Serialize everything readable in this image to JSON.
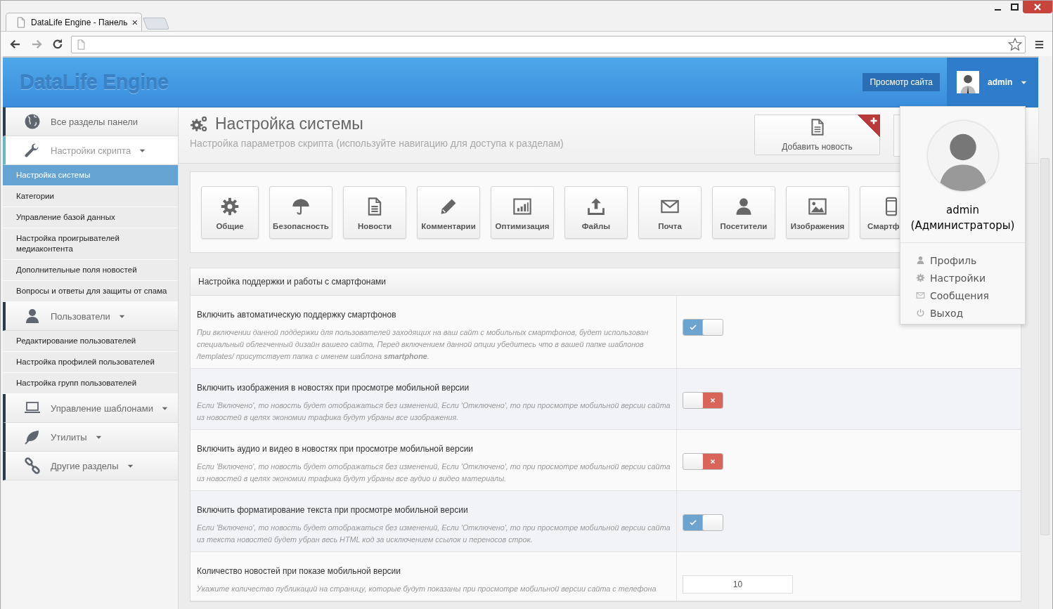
{
  "browser": {
    "tab_title": "DataLife Engine - Панель",
    "tab_close": "×"
  },
  "header": {
    "logo": "DataLife Engine",
    "view_site_button": "Просмотр сайта",
    "user_name": "admin"
  },
  "sidebar": {
    "groups": [
      {
        "label": "Все разделы панели",
        "kind": "link",
        "active": false
      },
      {
        "label": "Настройки скрипта",
        "kind": "menu",
        "active": true,
        "children": [
          {
            "label": "Настройка системы",
            "selected": true
          },
          {
            "label": "Категории",
            "selected": false
          },
          {
            "label": "Управление базой данных",
            "selected": false
          },
          {
            "label": "Настройка проигрывателей медиаконтента",
            "selected": false
          },
          {
            "label": "Дополнительные поля новостей",
            "selected": false
          },
          {
            "label": "Вопросы и ответы для защиты от спама",
            "selected": false
          }
        ]
      },
      {
        "label": "Пользователи",
        "kind": "menu",
        "active": false,
        "children": [
          {
            "label": "Редактирование пользователей",
            "selected": false
          },
          {
            "label": "Настройка профилей пользователей",
            "selected": false
          },
          {
            "label": "Настройка групп пользователей",
            "selected": false
          }
        ]
      },
      {
        "label": "Управление шаблонами",
        "kind": "menu",
        "active": false
      },
      {
        "label": "Утилиты",
        "kind": "menu",
        "active": false
      },
      {
        "label": "Другие разделы",
        "kind": "menu",
        "active": false
      }
    ]
  },
  "page_header": {
    "title": "Настройка системы",
    "subtitle": "Настройка параметров скрипта (используйте навигацию для доступа к разделам)",
    "quick_button": "Добавить новость"
  },
  "tiles": [
    {
      "label": "Общие"
    },
    {
      "label": "Безопасность"
    },
    {
      "label": "Новости"
    },
    {
      "label": "Комментарии"
    },
    {
      "label": "Оптимизация"
    },
    {
      "label": "Файлы"
    },
    {
      "label": "Почта"
    },
    {
      "label": "Посетители"
    },
    {
      "label": "Изображения"
    },
    {
      "label": "Смартф"
    }
  ],
  "settings": {
    "title": "Настройка поддержки и работы с смартфонами",
    "rows": [
      {
        "title": "Включить автоматическую поддержку смартфонов",
        "description": "При включении данной поддержки для пользователей заходящих на ваш сайт с мобильных смартфонов, будет использован специальный облегченный дизайн вашего сайта. Перед включением данной опции убедитесь что в вашей папке шаблонов /templates/ присутствует папка с именем шаблона **smartphone**.",
        "kind": "toggle",
        "on": true
      },
      {
        "title": "Включить изображения в новостях при просмотре мобильной версии",
        "description": "Если 'Включено', то новость будет отображаться без изменений, Если 'Отключено', то при просмотре мобильной версии сайта из новостей в целях экономии трафика будут убраны все изображения.",
        "kind": "toggle",
        "on": false
      },
      {
        "title": "Включить аудио и видео в новостях при просмотре мобильной версии",
        "description": "Если 'Включено', то новость будет отображаться без изменений, Если 'Отключено', то при просмотре мобильной версии сайта из новостей в целях экономии трафика будут убраны все аудио и видео материалы.",
        "kind": "toggle",
        "on": false
      },
      {
        "title": "Включить форматирование текста при просмотре мобильной версии",
        "description": "Если 'Включено', то новость будет отображаться без изменений, Если 'Отключено', то при просмотре мобильной версии сайта из текста новостей будет убран весь HTML код за исключением ссылок и переносов строк.",
        "kind": "toggle",
        "on": true
      },
      {
        "title": "Количество новостей при показе мобильной версии",
        "description": "Укажите количество публикаций на страницу, которые будут показаны при просмотре мобильной версии сайта с телефона",
        "kind": "number",
        "value": "10"
      }
    ]
  },
  "user_menu": {
    "name": "admin",
    "group": "(Администраторы)",
    "items": [
      {
        "label": "Профиль"
      },
      {
        "label": "Настройки"
      },
      {
        "label": "Сообщения"
      },
      {
        "label": "Выход"
      }
    ]
  }
}
